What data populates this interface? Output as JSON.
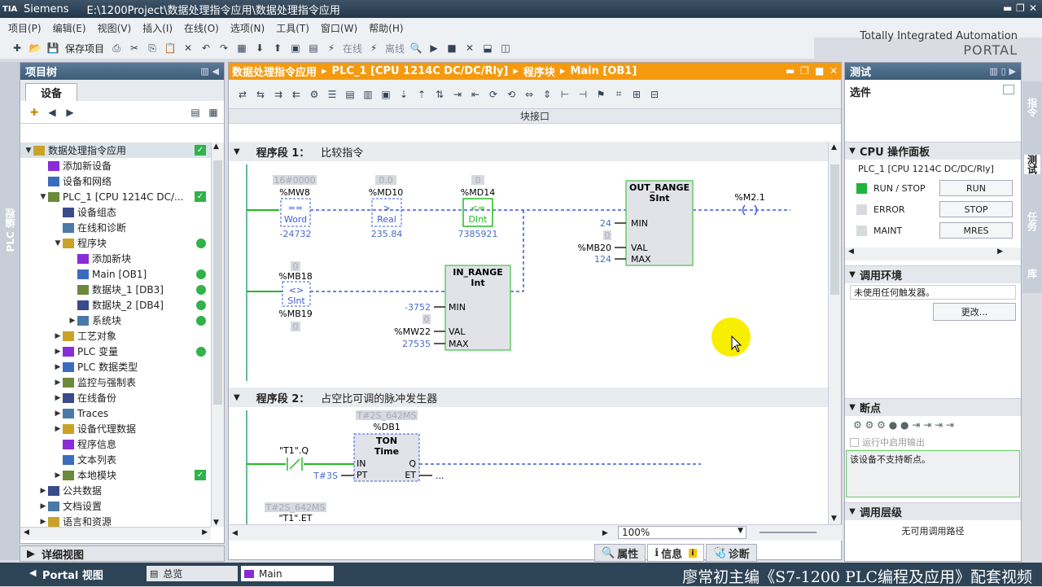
{
  "window": {
    "app": "Siemens",
    "path": "E:\\1200Project\\数据处理指令应用\\数据处理指令应用",
    "logo": "TIA"
  },
  "menu": [
    "项目(P)",
    "编辑(E)",
    "视图(V)",
    "插入(I)",
    "在线(O)",
    "选项(N)",
    "工具(T)",
    "窗口(W)",
    "帮助(H)"
  ],
  "toolbar": {
    "save_label": "保存项目",
    "online_label": "在线",
    "offline_label": "离线"
  },
  "brand": {
    "line1": "Totally Integrated Automation",
    "line2": "PORTAL"
  },
  "left_vertical_tab": "PLC 编程",
  "project_tree": {
    "title": "项目树",
    "tab": "设备",
    "items": [
      {
        "label": "数据处理指令应用",
        "indent": 0,
        "twisty": "▼",
        "status": "check"
      },
      {
        "label": "添加新设备",
        "indent": 1,
        "twisty": "",
        "status": ""
      },
      {
        "label": "设备和网络",
        "indent": 1,
        "twisty": "",
        "status": ""
      },
      {
        "label": "PLC_1 [CPU 1214C DC/...",
        "indent": 1,
        "twisty": "▼",
        "status": "check"
      },
      {
        "label": "设备组态",
        "indent": 2,
        "twisty": "",
        "status": ""
      },
      {
        "label": "在线和诊断",
        "indent": 2,
        "twisty": "",
        "status": ""
      },
      {
        "label": "程序块",
        "indent": 2,
        "twisty": "▼",
        "status": "dot"
      },
      {
        "label": "添加新块",
        "indent": 3,
        "twisty": "",
        "status": ""
      },
      {
        "label": "Main [OB1]",
        "indent": 3,
        "twisty": "",
        "status": "dot"
      },
      {
        "label": "数据块_1 [DB3]",
        "indent": 3,
        "twisty": "",
        "status": "dot"
      },
      {
        "label": "数据块_2 [DB4]",
        "indent": 3,
        "twisty": "",
        "status": "dot"
      },
      {
        "label": "系统块",
        "indent": 3,
        "twisty": "▶",
        "status": "dot"
      },
      {
        "label": "工艺对象",
        "indent": 2,
        "twisty": "▶",
        "status": ""
      },
      {
        "label": "PLC 变量",
        "indent": 2,
        "twisty": "▶",
        "status": "dot"
      },
      {
        "label": "PLC 数据类型",
        "indent": 2,
        "twisty": "▶",
        "status": ""
      },
      {
        "label": "监控与强制表",
        "indent": 2,
        "twisty": "▶",
        "status": ""
      },
      {
        "label": "在线备份",
        "indent": 2,
        "twisty": "▶",
        "status": ""
      },
      {
        "label": "Traces",
        "indent": 2,
        "twisty": "▶",
        "status": ""
      },
      {
        "label": "设备代理数据",
        "indent": 2,
        "twisty": "▶",
        "status": ""
      },
      {
        "label": "程序信息",
        "indent": 2,
        "twisty": "",
        "status": ""
      },
      {
        "label": "文本列表",
        "indent": 2,
        "twisty": "",
        "status": ""
      },
      {
        "label": "本地模块",
        "indent": 2,
        "twisty": "▶",
        "status": "check"
      },
      {
        "label": "公共数据",
        "indent": 1,
        "twisty": "▶",
        "status": ""
      },
      {
        "label": "文档设置",
        "indent": 1,
        "twisty": "▶",
        "status": ""
      },
      {
        "label": "语言和资源",
        "indent": 1,
        "twisty": "▶",
        "status": ""
      }
    ]
  },
  "detail_view": "详细视图",
  "editor": {
    "breadcrumb": [
      "数据处理指令应用",
      "PLC_1 [CPU 1214C DC/DC/Rly]",
      "程序块",
      "Main [OB1]"
    ],
    "interface_label": "块接口",
    "zoom": "100%",
    "network1": {
      "label": "程序段 1：",
      "comment": "比较指令",
      "c1": {
        "mon": "16#0000",
        "var": "%MW8",
        "op": "==",
        "type": "Word",
        "val": "-24732"
      },
      "c2": {
        "mon": "0.0",
        "var": "%MD10",
        "op": ">",
        "type": "Real",
        "val": "235.84"
      },
      "c3": {
        "mon": "0",
        "var": "%MD14",
        "op": "<=",
        "type": "DInt",
        "val": "7385921"
      },
      "out_range": {
        "title": "OUT_RANGE",
        "type": "SInt",
        "min_val": "24",
        "min": "MIN",
        "val_mon": "0",
        "val_var": "%MB20",
        "val": "VAL",
        "max_val": "124",
        "max": "MAX"
      },
      "coil": "%M2.1",
      "c4": {
        "mon": "0",
        "var": "%MB18",
        "op": "<>",
        "type": "SInt",
        "var2": "%MB19",
        "mon2": "0"
      },
      "in_range": {
        "title": "IN_RANGE",
        "type": "Int",
        "min_val": "-3752",
        "min": "MIN",
        "val_mon": "0",
        "val_var": "%MW22",
        "val": "VAL",
        "max_val": "27535",
        "max": "MAX"
      }
    },
    "network2": {
      "label": "程序段 2：",
      "comment": "占空比可调的脉冲发生器",
      "ton": {
        "mon": "T#2S_642MS",
        "db": "%DB1",
        "title": "TON",
        "type": "Time",
        "in": "IN",
        "pt": "PT",
        "q": "Q",
        "et": "ET",
        "pt_val": "T#3S",
        "et_val": "..."
      },
      "contact": "\"T1\".Q",
      "c2_mon": "T#2S_642MS",
      "c2_var": "\"T1\".ET"
    }
  },
  "bottom_tabs": [
    "属性",
    "信息",
    "诊断"
  ],
  "task": {
    "title": "测试",
    "options": "选件",
    "cpu_panel": {
      "title": "CPU 操作面板",
      "device": "PLC_1 [CPU 1214C DC/DC/Rly]",
      "rows": [
        {
          "label": "RUN / STOP",
          "button": "RUN",
          "led": "#1fb43c"
        },
        {
          "label": "ERROR",
          "button": "STOP",
          "led": "#d8dbde"
        },
        {
          "label": "MAINT",
          "button": "MRES",
          "led": "#d8dbde"
        }
      ]
    },
    "debug_env": {
      "title": "调用环境",
      "text": "未使用任何触发器。",
      "button": "更改..."
    },
    "breakpoints": {
      "title": "断点",
      "checkbox": "运行中启用输出",
      "text": "该设备不支持断点。"
    },
    "call_level": {
      "title": "调用层级",
      "text": "无可用调用路径"
    }
  },
  "right_vertical_tabs": [
    "指令",
    "测试",
    "任务",
    "库"
  ],
  "statusbar": {
    "portal": "Portal 视图",
    "tasks": [
      "总览",
      "Main"
    ],
    "watermark": "廖常初主编《S7-1200 PLC编程及应用》配套视频"
  }
}
